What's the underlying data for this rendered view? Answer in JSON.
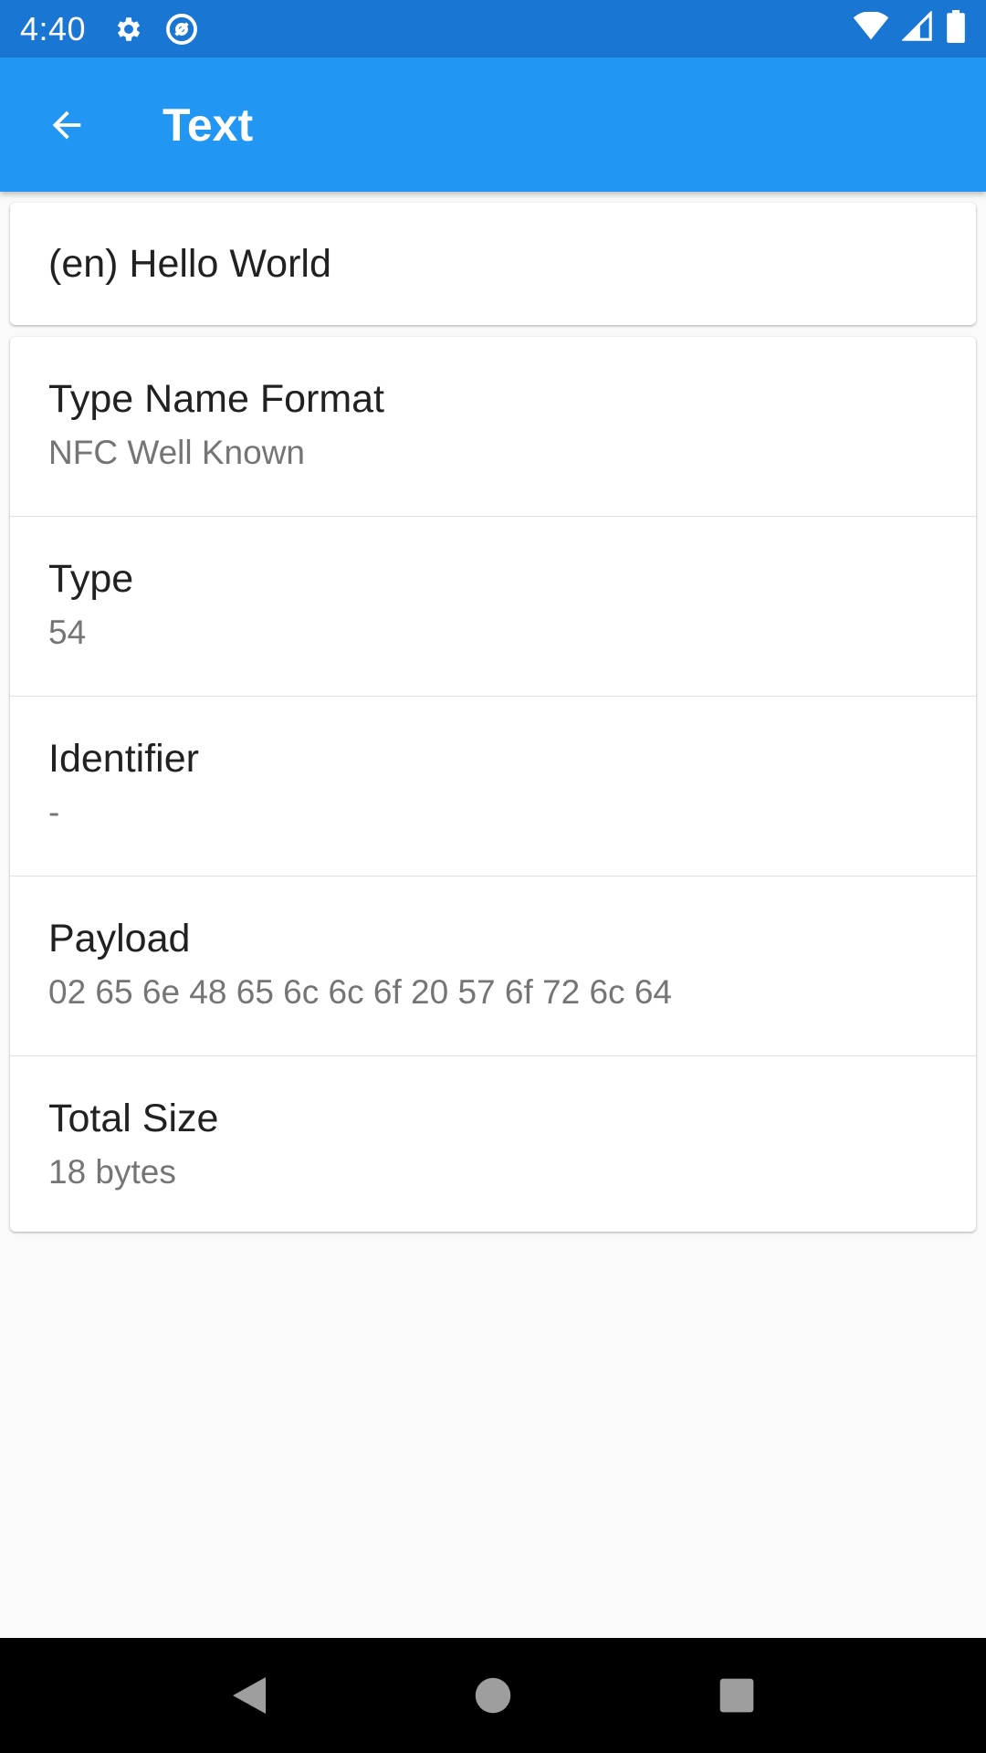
{
  "status_bar": {
    "time": "4:40",
    "icons": [
      "gear-icon",
      "at-sign-icon",
      "wifi-icon",
      "signal-icon",
      "battery-icon"
    ]
  },
  "app_bar": {
    "title": "Text",
    "back_icon": "arrow-back-icon"
  },
  "record_text": "(en) Hello World",
  "details": [
    {
      "label": "Type Name Format",
      "value": "NFC Well Known"
    },
    {
      "label": "Type",
      "value": "54"
    },
    {
      "label": "Identifier",
      "value": "-"
    },
    {
      "label": "Payload",
      "value": "02 65 6e 48 65 6c 6c 6f 20 57 6f 72 6c 64"
    },
    {
      "label": "Total Size",
      "value": "18 bytes"
    }
  ],
  "nav_bar": {
    "icons": [
      "back-triangle-icon",
      "home-circle-icon",
      "recents-square-icon"
    ]
  },
  "colors": {
    "status_bar": "#1976d2",
    "app_bar": "#2196f3",
    "background": "#fafafa",
    "secondary_text": "#757575"
  }
}
